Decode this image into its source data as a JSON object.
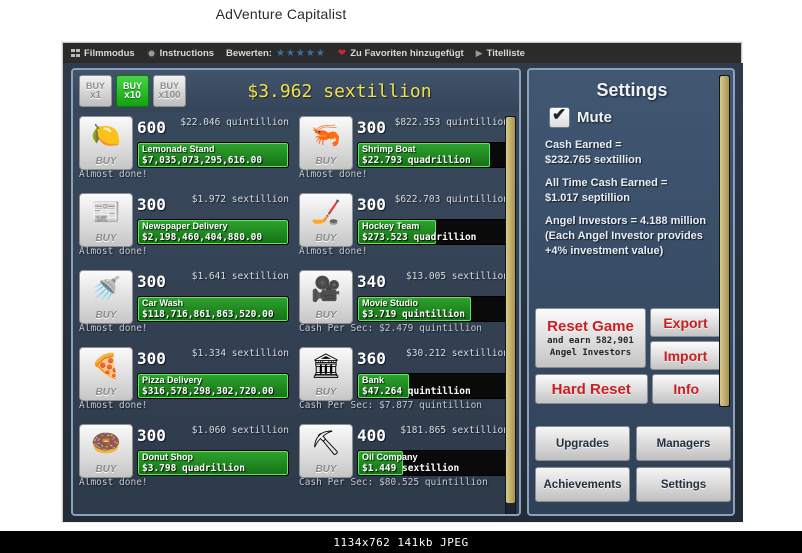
{
  "page_title": "AdVenture Capitalist",
  "toolbar": {
    "film_mode": "Filmmodus",
    "instructions": "Instructions",
    "rate_label": "Bewerten:",
    "stars": "★★★★★",
    "favorite": "Zu Favoriten hinzugefügt",
    "title_list": "Titelliste"
  },
  "game": {
    "money": "$3.962 sextillion",
    "buy_multipliers": [
      {
        "top": "BUY",
        "bottom": "x1",
        "active": false
      },
      {
        "top": "BUY",
        "bottom": "x10",
        "active": true
      },
      {
        "top": "BUY",
        "bottom": "x100",
        "active": false
      }
    ],
    "buy_label": "BUY",
    "businesses_left": [
      {
        "name": "Lemonade Stand",
        "icon": "lemon-icon",
        "glyph": "🍋",
        "qty": "600",
        "cost": "$22.046 quintillion",
        "value": "$7,035,073,295,616.00",
        "status": "Almost done!",
        "progress": 100
      },
      {
        "name": "Newspaper Delivery",
        "icon": "newspaper-icon",
        "glyph": "📰",
        "qty": "300",
        "cost": "$1.972 sextillion",
        "value": "$2,198,460,404,880.00",
        "status": "Almost done!",
        "progress": 100
      },
      {
        "name": "Car Wash",
        "icon": "carwash-icon",
        "glyph": "🚿",
        "qty": "300",
        "cost": "$1.641 sextillion",
        "value": "$118,716,861,863,520.00",
        "status": "Almost done!",
        "progress": 100
      },
      {
        "name": "Pizza Delivery",
        "icon": "pizza-icon",
        "glyph": "🍕",
        "qty": "300",
        "cost": "$1.334 sextillion",
        "value": "$316,578,298,302,720.00",
        "status": "Almost done!",
        "progress": 100
      },
      {
        "name": "Donut Shop",
        "icon": "donut-icon",
        "glyph": "🍩",
        "qty": "300",
        "cost": "$1.060 sextillion",
        "value": "$3.798 quadrillion",
        "status": "Almost done!",
        "progress": 100
      }
    ],
    "businesses_right": [
      {
        "name": "Shrimp Boat",
        "icon": "shrimp-icon",
        "glyph": "🦐",
        "qty": "300",
        "cost": "$822.353 quintillion",
        "value": "$22.793 quadrillion",
        "status": "Almost done!",
        "progress": 88
      },
      {
        "name": "Hockey Team",
        "icon": "hockey-icon",
        "glyph": "🏒",
        "qty": "300",
        "cost": "$622.703 quintillion",
        "value": "$273.523 quadrillion",
        "status": "Almost done!",
        "progress": 52
      },
      {
        "name": "Movie Studio",
        "icon": "movie-camera-icon",
        "glyph": "🎥",
        "qty": "340",
        "cost": "$13.005 sextillion",
        "value": "$3.719 quintillion",
        "status": "Cash Per Sec: $2.479 quintillion",
        "progress": 75
      },
      {
        "name": "Bank",
        "icon": "bank-icon",
        "glyph": "🏛",
        "qty": "360",
        "cost": "$30.212 sextillion",
        "value": "$47.264 quintillion",
        "status": "Cash Per Sec: $7.877 quintillion",
        "progress": 34
      },
      {
        "name": "Oil Company",
        "icon": "oil-pump-icon",
        "glyph": "⛏",
        "qty": "400",
        "cost": "$181.865 sextillion",
        "value": "$1.449 sextillion",
        "status": "Cash Per Sec: $80.525 quintillion",
        "progress": 30
      }
    ],
    "settings": {
      "title": "Settings",
      "mute_label": "Mute",
      "mute_checked": true,
      "cash_earned_label": "Cash Earned =",
      "cash_earned_value": "$232.765 sextillion",
      "all_time_label": "All Time Cash Earned =",
      "all_time_value": "$1.017 septillion",
      "angel_line1": "Angel Investors = 4.188 million",
      "angel_line2": "(Each Angel Investor provides",
      "angel_line3": "+4% investment value)",
      "reset_game": "Reset Game",
      "reset_game_sub_line1": "and earn 582,901",
      "reset_game_sub_line2": "Angel Investors",
      "export": "Export",
      "import": "Import",
      "hard_reset": "Hard Reset",
      "info": "Info"
    },
    "nav": {
      "upgrades": "Upgrades",
      "managers": "Managers",
      "achievements": "Achievements",
      "settings": "Settings"
    }
  },
  "bottom_strip": "1134x762  141kb  JPEG",
  "colors": {
    "money": "#f2e14a",
    "progress_fill": "#2ea42e",
    "panel_border": "#8aa0bb",
    "red_button_text": "#c81f22"
  }
}
